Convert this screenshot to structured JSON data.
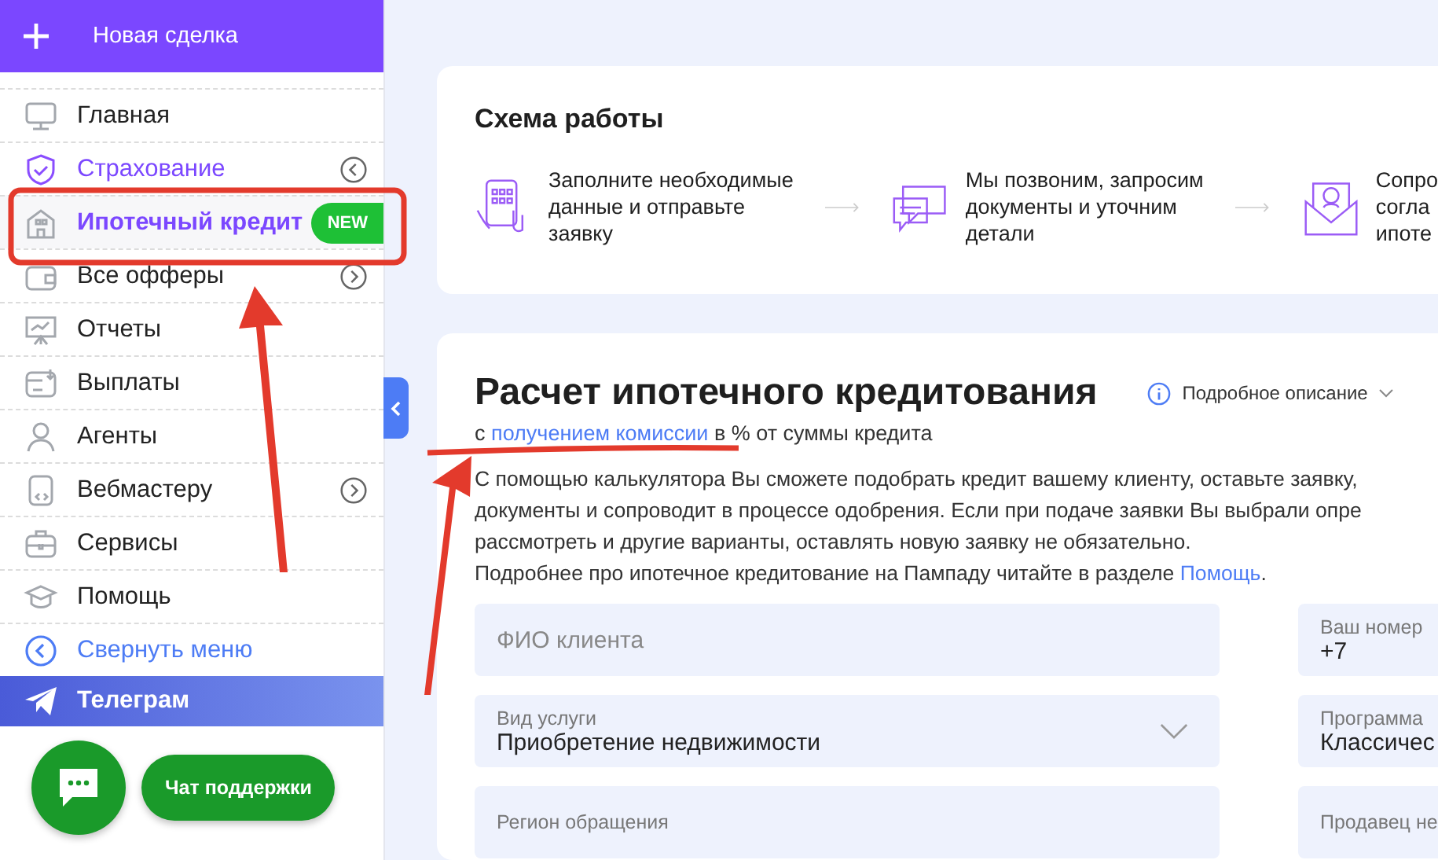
{
  "sidebar": {
    "new_deal": {
      "label": "Новая сделка"
    },
    "items": [
      {
        "kind": "item",
        "label": "Главная",
        "selected": false,
        "highlighted": false
      },
      {
        "kind": "item",
        "label": "Страхование",
        "selected": false,
        "highlighted": true,
        "expanded": true
      },
      {
        "kind": "item",
        "label": "Ипотечный кредит",
        "selected": true,
        "highlighted": true,
        "badge": "NEW"
      },
      {
        "kind": "item",
        "label": "Все офферы",
        "selected": false,
        "highlighted": false,
        "expanded": false
      },
      {
        "kind": "item",
        "label": "Отчеты",
        "selected": false,
        "highlighted": false
      },
      {
        "kind": "item",
        "label": "Выплаты",
        "selected": false,
        "highlighted": false
      },
      {
        "kind": "item",
        "label": "Агенты",
        "selected": false,
        "highlighted": false
      },
      {
        "kind": "item",
        "label": "Вебмастеру",
        "selected": false,
        "highlighted": false,
        "expanded": false
      },
      {
        "kind": "item",
        "label": "Сервисы",
        "selected": false,
        "highlighted": false
      },
      {
        "kind": "item",
        "label": "Помощь",
        "selected": false,
        "highlighted": false
      },
      {
        "kind": "collapse",
        "label": "Свернуть меню"
      },
      {
        "kind": "telegram",
        "label": "Телеграм"
      }
    ],
    "support": {
      "label": "Чат поддержки"
    }
  },
  "scheme": {
    "title": "Схема работы",
    "steps": [
      {
        "lines": [
          "Заполните необходимые",
          "данные и отправьте",
          "заявку"
        ]
      },
      {
        "lines": [
          "Мы позвоним, запросим",
          "документы и уточним",
          "детали"
        ]
      },
      {
        "lines": [
          "Сопро",
          "согла",
          "ипоте"
        ]
      }
    ]
  },
  "calculator": {
    "title": "Расчет ипотечного кредитования",
    "details": "Подробное описание",
    "subtitle": {
      "before": "с ",
      "link": "получением комиссии",
      "after": " в % от суммы кредита"
    },
    "description": [
      "С помощью калькулятора Вы сможете подобрать кредит вашему клиенту, оставьте заявку,",
      "документы и сопроводит в процессе одобрения. Если при подаче заявки Вы выбрали опре",
      "рассмотреть и другие варианты, оставлять новую заявку не обязательно."
    ],
    "help_line": {
      "before": "Подробнее про ипотечное кредитование на Пампаду читайте в разделе ",
      "link": "Помощь",
      "after": "."
    },
    "fields": [
      {
        "kind": "input",
        "placeholder": "ФИО клиента"
      },
      {
        "kind": "input",
        "label": "Ваш номер",
        "value": "+7"
      },
      {
        "kind": "select",
        "label": "Вид услуги",
        "value": "Приобретение недвижимости"
      },
      {
        "kind": "input",
        "label": "Программа",
        "value": "Классичес"
      },
      {
        "kind": "input",
        "label": "Регион обращения"
      },
      {
        "kind": "input",
        "label": "Продавец не"
      }
    ]
  }
}
